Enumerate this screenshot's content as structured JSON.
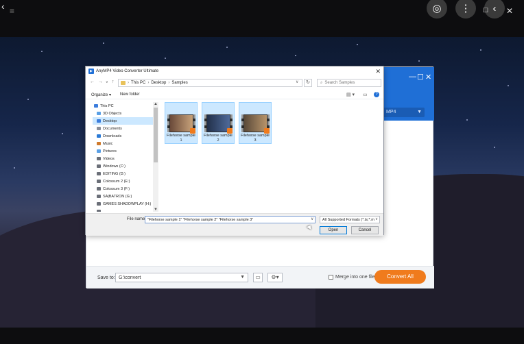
{
  "colors": {
    "accent": "#1f6fd6",
    "convert_button": "#f07b1d",
    "selection": "#cce8ff"
  },
  "viewer": {
    "menu_icon": "hamburger-icon",
    "back_icon": "chevron-left-icon"
  },
  "app": {
    "format_select": "MP4",
    "bottom": {
      "save_to_label": "Save to:",
      "save_to_value": "G:\\convert",
      "merge_label": "Merge into one file",
      "convert_all_label": "Convert All"
    }
  },
  "dialog": {
    "title": "AnyMP4 Video Converter Ultimate",
    "address": [
      "This PC",
      "Desktop",
      "Samples"
    ],
    "search_placeholder": "Search Samples",
    "toolbar": {
      "organize": "Organize ▾",
      "new_folder": "New folder"
    },
    "nav": [
      {
        "label": "This PC",
        "icon": "pc-icon",
        "color": "#3b7ddd"
      },
      {
        "label": "3D Objects",
        "icon": "cube-icon",
        "color": "#5aa0e6"
      },
      {
        "label": "Desktop",
        "icon": "desktop-icon",
        "color": "#3b7ddd"
      },
      {
        "label": "Documents",
        "icon": "document-icon",
        "color": "#8a8f99"
      },
      {
        "label": "Downloads",
        "icon": "download-icon",
        "color": "#2b7ad6"
      },
      {
        "label": "Music",
        "icon": "music-icon",
        "color": "#d07a2b"
      },
      {
        "label": "Pictures",
        "icon": "pictures-icon",
        "color": "#5aa0e6"
      },
      {
        "label": "Videos",
        "icon": "video-icon",
        "color": "#6b6f78"
      },
      {
        "label": "Windows (C:)",
        "icon": "drive-icon",
        "color": "#6b6f78"
      },
      {
        "label": "EDITING (D:)",
        "icon": "drive-icon",
        "color": "#6b6f78"
      },
      {
        "label": "Colossum 2 (E:)",
        "icon": "drive-icon",
        "color": "#6b6f78"
      },
      {
        "label": "Colossum 3 (F:)",
        "icon": "drive-icon",
        "color": "#6b6f78"
      },
      {
        "label": "SA|BATRON (G:)",
        "icon": "drive-icon",
        "color": "#6b6f78"
      },
      {
        "label": "GAMES SHADOWPLAY (H:)",
        "icon": "drive-icon",
        "color": "#6b6f78"
      },
      {
        "label": "...",
        "icon": "drive-icon",
        "color": "#6b6f78"
      }
    ],
    "files": [
      {
        "line1": "Filehorse sample",
        "line2": "1"
      },
      {
        "line1": "Filehorse sample",
        "line2": "2"
      },
      {
        "line1": "Filehorse sample",
        "line2": "3"
      }
    ],
    "file_name_label": "File name:",
    "file_name_value": "\"Filehorse sample 1\" \"Filehorse sample 2\" \"Filehorse sample 3\"",
    "file_type": "All Supported Formats (*.ts;*.m",
    "open_label": "Open",
    "cancel_label": "Cancel"
  }
}
